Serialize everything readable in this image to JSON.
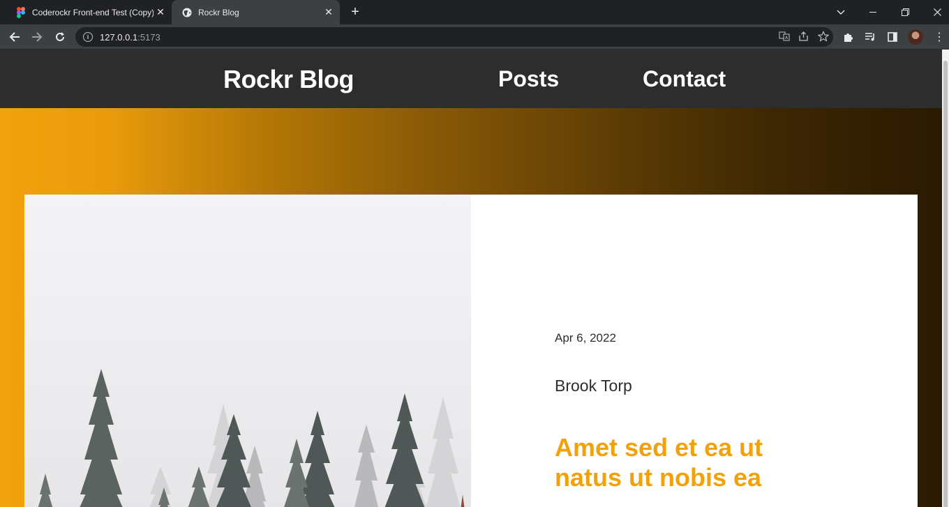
{
  "browser": {
    "tabs": [
      {
        "title": "Coderockr Front-end Test (Copy)",
        "favicon": "figma-icon",
        "active": false
      },
      {
        "title": "Rockr Blog",
        "favicon": "globe-icon",
        "active": true
      }
    ],
    "address": {
      "host": "127.0.0.1",
      "port": ":5173"
    }
  },
  "site": {
    "brand": "Rockr Blog",
    "nav": [
      "Posts",
      "Contact"
    ]
  },
  "featured_post": {
    "date": "Apr 6, 2022",
    "author": "Brook Torp",
    "title": "Amet sed et ea ut natus ut nobis ea",
    "image": "snowy-forest-trees"
  },
  "colors": {
    "header_bg": "#2d2d2d",
    "accent": "#f1a10a",
    "hero_gradient_start": "#f2a20c",
    "hero_gradient_end": "#2a1a02"
  }
}
